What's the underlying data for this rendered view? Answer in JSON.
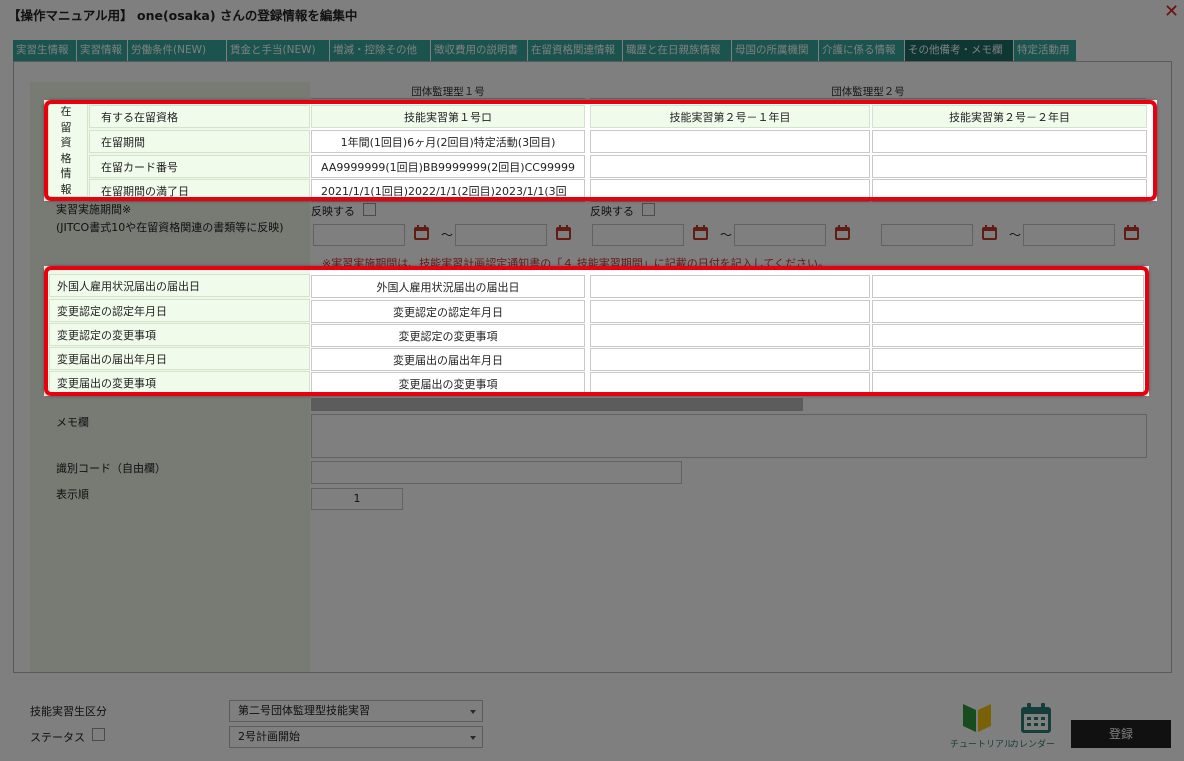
{
  "window": {
    "title": "【操作マニュアル用】 one(osaka) さんの登録情報を編集中",
    "close_label": "✕"
  },
  "tabs": [
    "実習生情報",
    "実習情報",
    "労働条件(NEW)",
    "賃金と手当(NEW)",
    "増減・控除その他",
    "徴収費用の説明書",
    "在留資格関連情報",
    "職歴と在日親族情報",
    "母国の所属機関",
    "介護に係る情報",
    "その他備考・メモ欄",
    "特定活動用"
  ],
  "active_tab_index": 10,
  "columns": {
    "group1": "団体監理型１号",
    "group2": "団体監理型２号"
  },
  "residence": {
    "side_label": "在留資格情報",
    "rows": [
      {
        "label": "有する在留資格",
        "c1": "技能実習第１号ロ",
        "c2": "技能実習第２号－１年目",
        "c3": "技能実習第２号－２年目"
      },
      {
        "label": "在留期間",
        "c1": "1年間(1回目)6ヶ月(2回目)特定活動(3回目)",
        "c2": "",
        "c3": ""
      },
      {
        "label": "在留カード番号",
        "c1": "AA9999999(1回目)BB9999999(2回目)CC99999",
        "c2": "",
        "c3": ""
      },
      {
        "label": "在留期間の満了日",
        "c1": "2021/1/1(1回目)2022/1/1(2回目)2023/1/1(3回",
        "c2": "",
        "c3": ""
      }
    ]
  },
  "period": {
    "label1": "実習実施期間※",
    "label2": "(JITCO書式10や在留資格関連の書類等に反映)",
    "reflect_label": "反映する",
    "tilde": "～",
    "note": "※実習実施期間は、技能実習計画認定通知書の「４ 技能実習期間」に記載の日付を記入してください。"
  },
  "notifications": [
    {
      "label": "外国人雇用状況届出の届出日",
      "c1": "外国人雇用状況届出の届出日"
    },
    {
      "label": "変更認定の認定年月日",
      "c1": "変更認定の認定年月日"
    },
    {
      "label": "変更認定の変更事項",
      "c1": "変更認定の変更事項"
    },
    {
      "label": "変更届出の届出年月日",
      "c1": "変更届出の届出年月日"
    },
    {
      "label": "変更届出の変更事項",
      "c1": "変更届出の変更事項"
    }
  ],
  "memo": {
    "label": "メモ欄"
  },
  "id_code": {
    "label": "識別コード（自由欄）"
  },
  "display_order": {
    "label": "表示順",
    "value": "1"
  },
  "bottom": {
    "category_label": "技能実習生区分",
    "category_value": "第二号団体監理型技能実習",
    "status_label": "ステータス",
    "status_value": "2号計画開始",
    "tutorial_label": "チュートリアル",
    "calendar_label": "カレンダー",
    "register_label": "登録"
  },
  "colors": {
    "tab": "#36a99c",
    "tab_active": "#1d6f66",
    "highlight": "#e8000e",
    "label_bg": "#e8f4e1"
  }
}
